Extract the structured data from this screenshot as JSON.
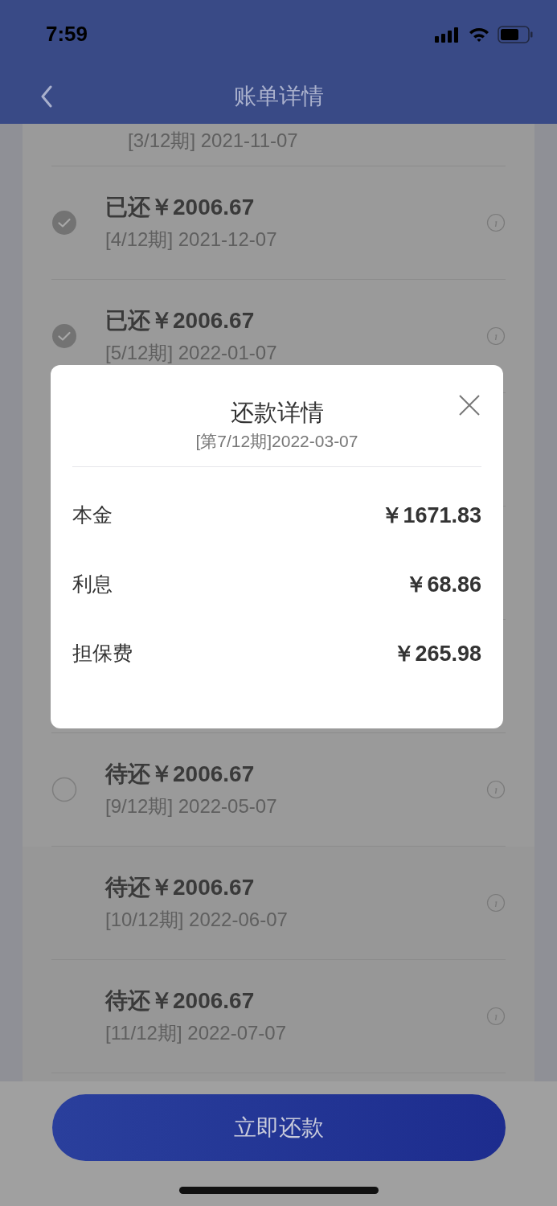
{
  "status_bar": {
    "time": "7:59"
  },
  "nav": {
    "title": "账单详情"
  },
  "rows": [
    {
      "period": "[3/12期] 2021-11-07"
    },
    {
      "title": "已还￥2006.67",
      "period": "[4/12期] 2021-12-07",
      "checked": true
    },
    {
      "title": "已还￥2006.67",
      "period": "[5/12期] 2022-01-07",
      "checked": true
    },
    {
      "kind": "hidden"
    },
    {
      "kind": "hidden"
    },
    {
      "kind": "hidden"
    },
    {
      "title": "待还￥2006.67",
      "period": "[9/12期] 2022-05-07",
      "checked": false
    }
  ],
  "rows_below": [
    {
      "title": "待还￥2006.67",
      "period": "[10/12期] 2022-06-07"
    },
    {
      "title": "待还￥2006.67",
      "period": "[11/12期] 2022-07-07"
    }
  ],
  "dialog": {
    "title": "还款详情",
    "subtitle": "[第7/12期]2022-03-07",
    "items": [
      {
        "label": "本金",
        "value": "￥1671.83"
      },
      {
        "label": "利息",
        "value": "￥68.86"
      },
      {
        "label": "担保费",
        "value": "￥265.98"
      }
    ]
  },
  "pay_button": "立即还款"
}
